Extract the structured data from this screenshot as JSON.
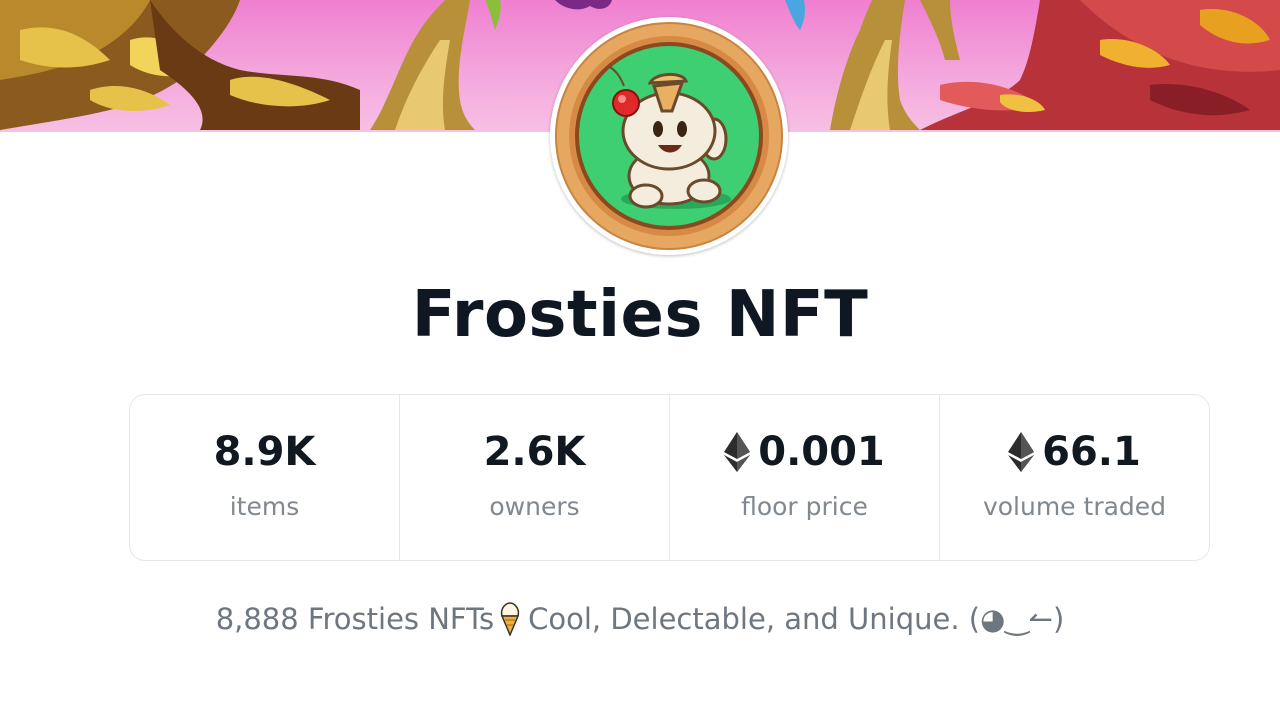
{
  "collection": {
    "title": "Frosties NFT",
    "description_before": "8,888 Frosties NFTs",
    "description_after": "Cool, Delectable, and Unique. (◕‿↼)",
    "description_icon": "ice-cream-icon"
  },
  "stats": [
    {
      "value": "8.9K",
      "label": "items",
      "icon": null
    },
    {
      "value": "2.6K",
      "label": "owners",
      "icon": null
    },
    {
      "value": "0.001",
      "label": "floor price",
      "icon": "ethereum-icon"
    },
    {
      "value": "66.1",
      "label": "volume traded",
      "icon": "ethereum-icon"
    }
  ],
  "colors": {
    "title": "#0f1722",
    "label": "#808890",
    "banner_pink": "#f07fd0",
    "avatar_green": "#3ecf72",
    "avatar_ring": "#d9914a"
  }
}
